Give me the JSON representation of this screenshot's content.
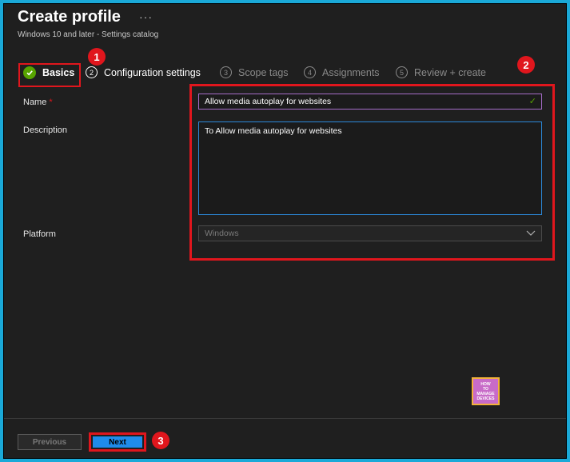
{
  "header": {
    "title": "Create profile",
    "more_icon": "ellipsis-icon",
    "subtitle": "Windows 10 and later - Settings catalog"
  },
  "steps": [
    {
      "num": "",
      "label": "Basics",
      "state": "completed"
    },
    {
      "num": "2",
      "label": "Configuration settings",
      "state": "enabled"
    },
    {
      "num": "3",
      "label": "Scope tags",
      "state": "disabled"
    },
    {
      "num": "4",
      "label": "Assignments",
      "state": "disabled"
    },
    {
      "num": "5",
      "label": "Review + create",
      "state": "disabled"
    }
  ],
  "form": {
    "name_label": "Name",
    "name_required": "*",
    "name_value": "Allow media autoplay for websites",
    "description_label": "Description",
    "description_value": "To Allow media autoplay for websites",
    "platform_label": "Platform",
    "platform_value": "Windows"
  },
  "annotations": {
    "badge1": "1",
    "badge2": "2",
    "badge3": "3"
  },
  "logo": {
    "line1": "HOW",
    "line2": "TO",
    "line3": "MANAGE",
    "line4": "DEVICES"
  },
  "footer": {
    "previous_label": "Previous",
    "next_label": "Next"
  },
  "colors": {
    "accent": "#1f8cea",
    "annotation": "#e0161d",
    "success": "#57a300",
    "frame": "#1aa9d8"
  }
}
